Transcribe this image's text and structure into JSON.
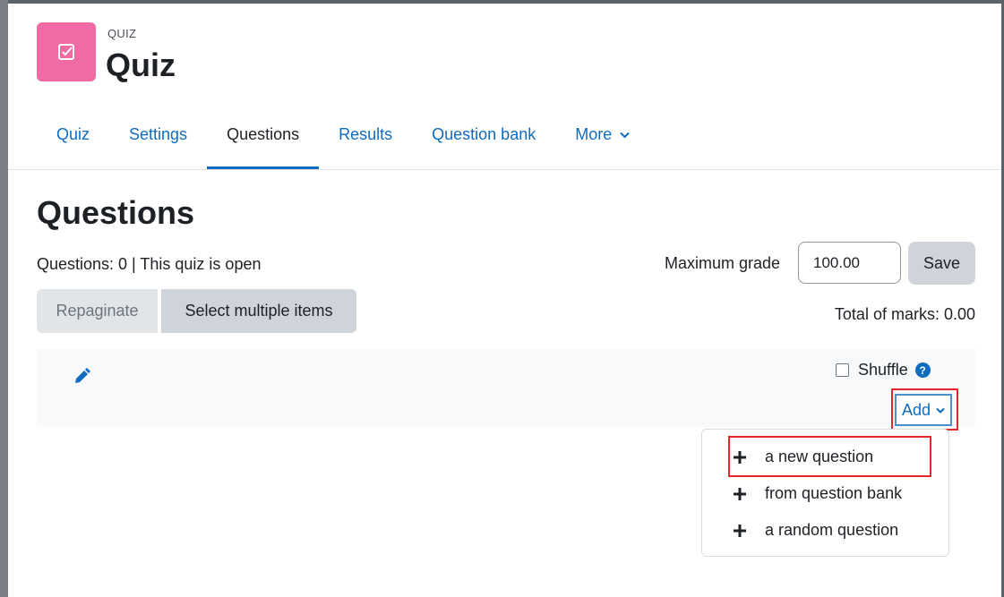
{
  "header": {
    "overline": "QUIZ",
    "title": "Quiz",
    "icon": "checkbox-icon"
  },
  "tabs": [
    {
      "label": "Quiz",
      "active": false
    },
    {
      "label": "Settings",
      "active": false
    },
    {
      "label": "Questions",
      "active": true
    },
    {
      "label": "Results",
      "active": false
    },
    {
      "label": "Question bank",
      "active": false
    },
    {
      "label": "More",
      "active": false
    }
  ],
  "page": {
    "title": "Questions",
    "status": "Questions: 0 | This quiz is open",
    "max_grade_label": "Maximum grade",
    "max_grade_value": "100.00",
    "save_label": "Save",
    "repaginate_label": "Repaginate",
    "select_multiple_label": "Select multiple items",
    "total_marks": "Total of marks: 0.00"
  },
  "section": {
    "shuffle_label": "Shuffle",
    "shuffle_checked": false,
    "add_label": "Add"
  },
  "add_menu": {
    "items": [
      {
        "label": "a new question",
        "icon": "plus-icon"
      },
      {
        "label": "from question bank",
        "icon": "plus-icon"
      },
      {
        "label": "a random question",
        "icon": "plus-icon"
      }
    ]
  },
  "colors": {
    "accent": "#0f6cbf",
    "activity_icon": "#f06aa6",
    "highlight": "#e3262b"
  }
}
